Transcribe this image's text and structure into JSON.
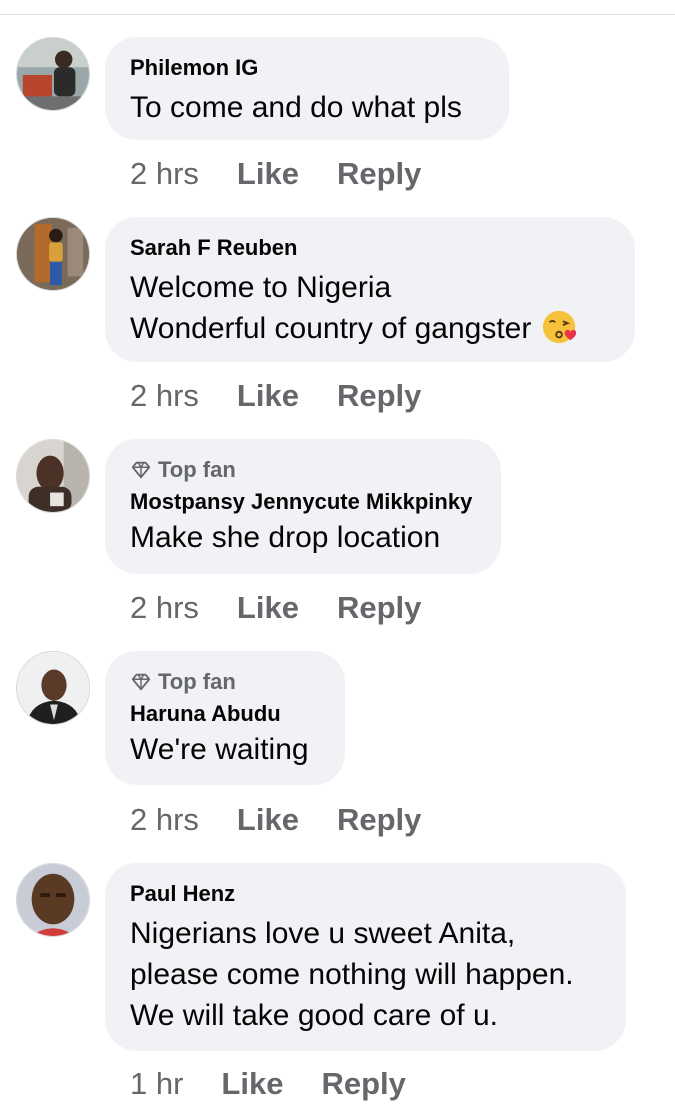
{
  "comments": [
    {
      "author": "Philemon IG",
      "lines": [
        "To come and do what pls"
      ],
      "time": "2 hrs",
      "like": "Like",
      "reply": "Reply"
    },
    {
      "author": "Sarah F Reuben",
      "lines": [
        "Welcome to Nigeria",
        "Wonderful country of gangster"
      ],
      "emoji": "face-blowing-kiss",
      "time": "2 hrs",
      "like": "Like",
      "reply": "Reply"
    },
    {
      "badge": "Top fan",
      "author": "Mostpansy Jennycute Mikkpinky",
      "lines": [
        "Make she drop location"
      ],
      "time": "2 hrs",
      "like": "Like",
      "reply": "Reply"
    },
    {
      "badge": "Top fan",
      "author": "Haruna Abudu",
      "lines": [
        "We're waiting"
      ],
      "time": "2 hrs",
      "like": "Like",
      "reply": "Reply"
    },
    {
      "author": "Paul Henz",
      "lines": [
        "Nigerians love u sweet Anita,",
        "please come nothing will happen.",
        "We will take good care of u."
      ],
      "time": "1 hr",
      "like": "Like",
      "reply": "Reply"
    }
  ]
}
